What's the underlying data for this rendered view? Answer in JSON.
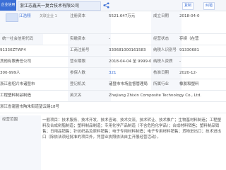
{
  "header": {
    "side_tag": "企业信用信息",
    "company_title": "浙江志鑫天一复合技术有限公司",
    "buttons": [
      "复制",
      "纠错"
    ]
  },
  "rows": [
    {
      "legal_rep_label": "法定代表人",
      "legal_name": "江浩翔",
      "legal_more": "关联企业 1",
      "c2": "注册资本",
      "c3": "5521.647万元",
      "c4": "成立日期",
      "c5": "2018-04-0"
    },
    {
      "c0": "统一社会信用代码",
      "c2": "实缴资本",
      "c3": "-",
      "c4": "经营状态",
      "c5": "存续（在营"
    },
    {
      "c0": "91330ZTWF4",
      "c2": "工商注册号",
      "c3": "330681000161583",
      "c4": "纳税人识别号",
      "c5": "91330681"
    },
    {
      "c0": "其他有限责任公司",
      "c2": "营业期限",
      "c3": "2018-04-04 至 9999-09-09",
      "c4": "纳税人资质",
      "c5": "-"
    },
    {
      "c0": "300-999人",
      "c2": "参保人数",
      "c3": "321",
      "c4": "核准日期",
      "c5": "2020-12-"
    },
    {
      "c0": "浙江省绍兴市诸暨市",
      "c2": "登记机关",
      "c3": "诸暨市市场监督管理局",
      "c4": "所属行业",
      "c5": "橡胶和塑料"
    },
    {
      "c0": "工程塑料制品制造",
      "c2": "英文名",
      "c3": "Zhejiang Zhixin Composite Technology Co., Ltd."
    },
    {
      "c0": "浙江省诸暨市陶朱街道望云路18号",
      "c2": "",
      "c3": ""
    }
  ],
  "scope": {
    "label": "经营范围",
    "text": "一般项目：技术服务、技术开发、技术咨询、技术交流、技术转让、技术推广；生物基材料制造；工程塑料及合成树脂制造；塑料制品制造；专用化学产品制造（不含危险化学品）；合成材料销售；塑料制品销售；日用品销售；针纺织品及原料销售；电子专用材料制造；电子专用材料销售；货物进出口；技术进出口（除依法须经批准的项目外，凭营业执照依法自主开展经营活动）。"
  }
}
